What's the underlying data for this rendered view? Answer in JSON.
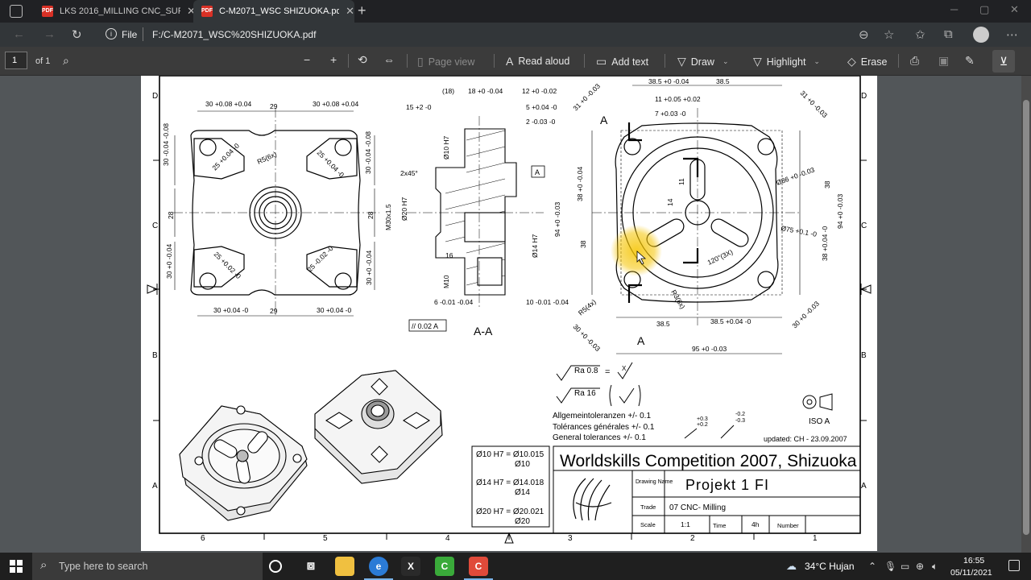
{
  "browser": {
    "tabs": [
      {
        "label": "LKS 2016_MILLING CNC_SURABAYA",
        "icon": "pdf-icon"
      },
      {
        "label": "C-M2071_WSC SHIZUOKA.pdf",
        "icon": "pdf-icon"
      }
    ],
    "address": {
      "scheme_label": "File",
      "url": "F:/C-M2071_WSC%20SHIZUOKA.pdf"
    }
  },
  "pdf_toolbar": {
    "page_current": "1",
    "page_total": "of 1",
    "page_view": "Page view",
    "read_aloud": "Read aloud",
    "add_text": "Add text",
    "draw": "Draw",
    "highlight": "Highlight",
    "erase": "Erase"
  },
  "drawing": {
    "title": "Worldskills Competition 2007, Shizuoka",
    "drawing_name_label": "Drawing Name",
    "drawing_name": "Projekt 1 FI",
    "trade_label": "Trade",
    "trade": "07 CNC- Milling",
    "scale_label": "Scale",
    "scale": "1:1",
    "time_label": "Time",
    "time": "4h",
    "number_label": "Number",
    "updated": "updated: CH - 23.09.2007",
    "iso": "ISO A",
    "tolerances": [
      "Allgemeintoleranzen +/- 0.1",
      "Tolérances générales +/- 0.1",
      "General tolerances +/- 0.1"
    ],
    "fits": [
      {
        "line1": "Ø10 H7 = Ø10.015",
        "line2": "Ø10"
      },
      {
        "line1": "Ø14 H7 = Ø14.018",
        "line2": "Ø14"
      },
      {
        "line1": "Ø20 H7 = Ø20.021",
        "line2": "Ø20"
      }
    ],
    "roughness": [
      {
        "label": "Ra 0.8",
        "eq": "=",
        "sym": "X"
      },
      {
        "label": "Ra 16",
        "eq": "",
        "sym": ""
      }
    ],
    "section_label": "A-A",
    "section_marks": [
      "A",
      "A"
    ],
    "flatness": "// 0.02 A",
    "datum": "A",
    "zone_letters": [
      "D",
      "C",
      "B",
      "A"
    ],
    "zone_numbers": [
      "6",
      "5",
      "4",
      "3",
      "2",
      "1"
    ],
    "left_dims": [
      "30 +0.08 +0.04",
      "29",
      "30 +0.08 +0.04",
      "30 -0.04 -0.08",
      "30 -0.04 -0.08",
      "28",
      "28",
      "R5(6x)",
      "25 +0.04 -0",
      "25 +0.04 -0",
      "25 +0.02 -0",
      "25 -0.02 -0",
      "30 +0 -0.04",
      "30 +0 -0.04",
      "30 +0.04 -0",
      "29",
      "30 +0.04 -0"
    ],
    "mid_dims": [
      "(18)",
      "18 +0 -0.04",
      "12 +0 -0.02",
      "15 +2 -0",
      "5 +0.04 -0",
      "2 -0.03 -0",
      "Ø10 H7",
      "2x45°",
      "M30x1.5",
      "Ø20 H7",
      "Ø14 H7",
      "16",
      "M10",
      "6 -0.01 -0.04",
      "10 -0.01 -0.04"
    ],
    "right_dims": [
      "38.5 +0 -0.04",
      "38.5",
      "31 +0 -0.03",
      "31 +0 -0.03",
      "11 +0.05 +0.02",
      "7 +0.03 -0",
      "Ø86 +0 -0.03",
      "38",
      "38 +0 -0.04",
      "94 +0 -0.03",
      "94 +0 -0.03",
      "14",
      "11",
      "38",
      "Ø75 +0.1 -0",
      "38 +0.04 -0",
      "120°(3X)",
      "R5(4x)",
      "R3(8x)",
      "30 +0 -0.03",
      "30 +0 -0.03",
      "38.5",
      "38.5 +0.04 -0",
      "95 +0 -0.03"
    ],
    "small_tol": [
      "+0.3",
      "+0.2",
      "-0.2",
      "-0.3"
    ]
  },
  "taskbar": {
    "search_placeholder": "Type here to search",
    "weather": "34°C Hujan",
    "time": "16:55",
    "date": "05/11/2021"
  },
  "colors": {
    "highlight_cursor": "#f5c400",
    "accent": "#d93025"
  }
}
